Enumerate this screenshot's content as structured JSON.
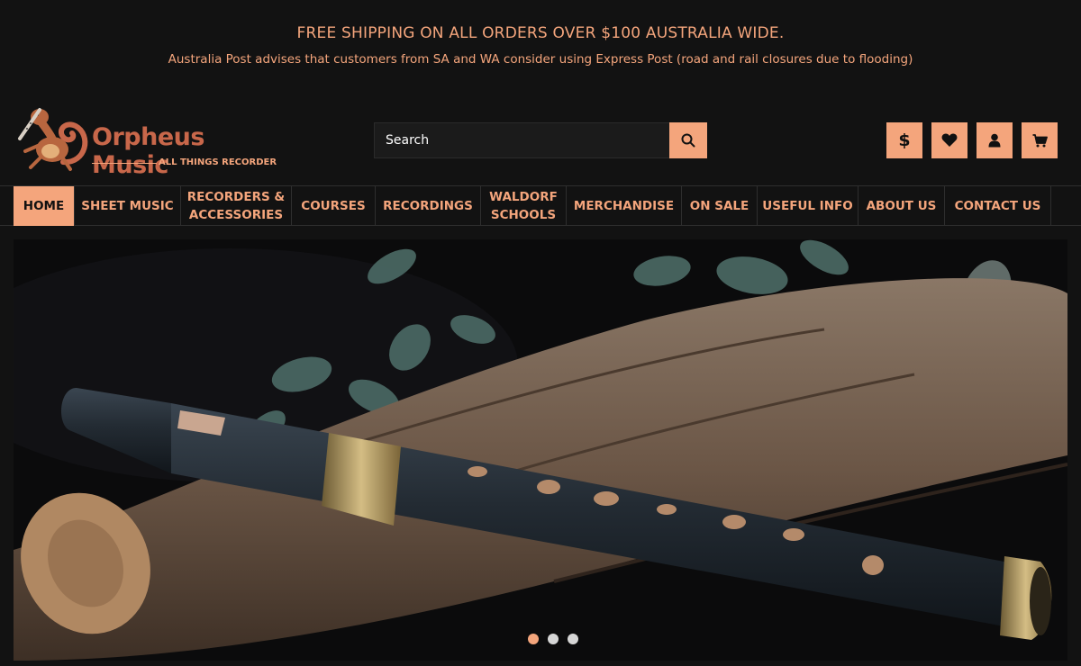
{
  "announcement": {
    "headline": "FREE SHIPPING ON ALL ORDERS OVER $100 AUSTRALIA WIDE.",
    "notice": "Australia Post advises that customers from SA and WA consider using Express Post (road and rail closures due to flooding)"
  },
  "logo": {
    "brand": "Orpheus Music",
    "tagline": "ALL THINGS RECORDER"
  },
  "search": {
    "placeholder": "Search",
    "icon": "search-icon"
  },
  "header_buttons": [
    {
      "name": "currency",
      "glyph": "$",
      "icon": "dollar-icon"
    },
    {
      "name": "wishlist",
      "icon": "heart-icon"
    },
    {
      "name": "account",
      "icon": "user-icon"
    },
    {
      "name": "cart",
      "icon": "cart-icon"
    }
  ],
  "nav": {
    "items": [
      {
        "label": "HOME",
        "active": true
      },
      {
        "label": "SHEET MUSIC"
      },
      {
        "label": "RECORDERS &\nACCESSORIES"
      },
      {
        "label": "COURSES"
      },
      {
        "label": "RECORDINGS"
      },
      {
        "label": "WALDORF\nSCHOOLS"
      },
      {
        "label": "MERCHANDISE"
      },
      {
        "label": "ON SALE"
      },
      {
        "label": "USEFUL INFO"
      },
      {
        "label": "ABOUT US"
      },
      {
        "label": "CONTACT US"
      }
    ]
  },
  "hero": {
    "slide_count": 3,
    "active_slide": 1
  },
  "colors": {
    "background": "#121212",
    "accent": "#f4a57c",
    "brand_text": "#c8674a"
  }
}
